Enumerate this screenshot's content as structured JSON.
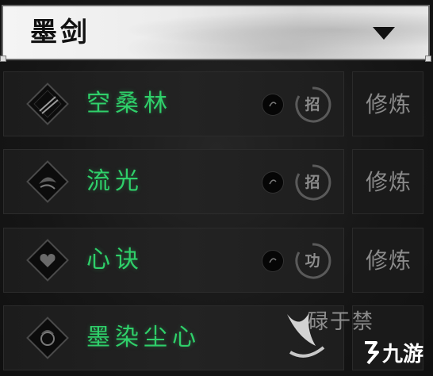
{
  "header": {
    "title": "墨剑",
    "dropdown_icon": "triangle-down-icon"
  },
  "skills": [
    {
      "name": "空桑林",
      "seal": "招",
      "action": "修炼",
      "emblem": "diamond-slash-emblem"
    },
    {
      "name": "流光",
      "seal": "招",
      "action": "修炼",
      "emblem": "diamond-wave-emblem"
    },
    {
      "name": "心诀",
      "seal": "功",
      "action": "修炼",
      "emblem": "diamond-heart-emblem"
    },
    {
      "name": "墨染尘心",
      "seal": "",
      "action": "",
      "emblem": "diamond-orb-emblem"
    }
  ],
  "watermark": {
    "partial_text": "碌于禁",
    "logo_text": "九游"
  },
  "colors": {
    "skill_name": "#2fd06a",
    "row_bg": "#1f1f1f",
    "action_text": "#8a8a8a",
    "header_bg": "#e8e8e8"
  }
}
